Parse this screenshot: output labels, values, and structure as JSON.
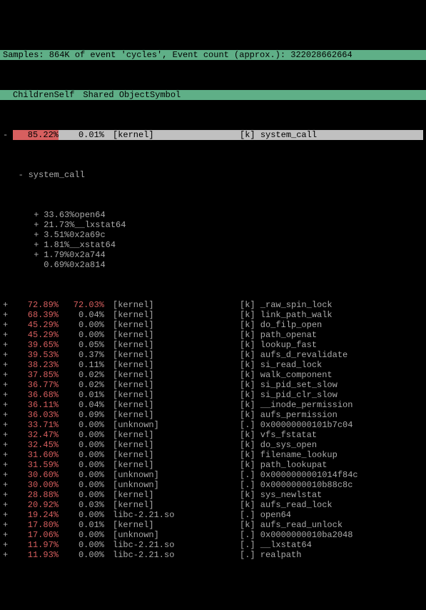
{
  "header": {
    "title_line": "Samples: 864K of event 'cycles', Event count (approx.): 322028662664",
    "cols": {
      "children": "Children",
      "self": "Self",
      "shared_object": "Shared Object",
      "symbol": "Symbol"
    }
  },
  "expanded": {
    "children": "85.22%",
    "self": "0.01%",
    "obj": "[kernel]",
    "mark": "[k]",
    "sym": "system_call",
    "tree_label": "system_call"
  },
  "tree_items": [
    {
      "exp": "+",
      "pct": "33.63%",
      "name": "open64"
    },
    {
      "exp": "+",
      "pct": "21.73%",
      "name": "__lxstat64"
    },
    {
      "exp": "+",
      "pct": "3.51%",
      "name": "0x2a69c"
    },
    {
      "exp": "+",
      "pct": "1.81%",
      "name": "__xstat64"
    },
    {
      "exp": "+",
      "pct": "1.79%",
      "name": "0x2a744"
    },
    {
      "exp": " ",
      "pct": "0.69%",
      "name": "0x2a814"
    }
  ],
  "rows": [
    {
      "exp": "+",
      "children": "72.89%",
      "self": "72.03%",
      "self_red": true,
      "obj": "[kernel]",
      "mark": "[k]",
      "sym": "_raw_spin_lock"
    },
    {
      "exp": "+",
      "children": "68.39%",
      "self": "0.04%",
      "obj": "[kernel]",
      "mark": "[k]",
      "sym": "link_path_walk"
    },
    {
      "exp": "+",
      "children": "45.29%",
      "self": "0.00%",
      "obj": "[kernel]",
      "mark": "[k]",
      "sym": "do_filp_open"
    },
    {
      "exp": "+",
      "children": "45.29%",
      "self": "0.00%",
      "obj": "[kernel]",
      "mark": "[k]",
      "sym": "path_openat"
    },
    {
      "exp": "+",
      "children": "39.65%",
      "self": "0.05%",
      "obj": "[kernel]",
      "mark": "[k]",
      "sym": "lookup_fast"
    },
    {
      "exp": "+",
      "children": "39.53%",
      "self": "0.37%",
      "obj": "[kernel]",
      "mark": "[k]",
      "sym": "aufs_d_revalidate"
    },
    {
      "exp": "+",
      "children": "38.23%",
      "self": "0.11%",
      "obj": "[kernel]",
      "mark": "[k]",
      "sym": "si_read_lock"
    },
    {
      "exp": "+",
      "children": "37.85%",
      "self": "0.02%",
      "obj": "[kernel]",
      "mark": "[k]",
      "sym": "walk_component"
    },
    {
      "exp": "+",
      "children": "36.77%",
      "self": "0.02%",
      "obj": "[kernel]",
      "mark": "[k]",
      "sym": "si_pid_set_slow"
    },
    {
      "exp": "+",
      "children": "36.68%",
      "self": "0.01%",
      "obj": "[kernel]",
      "mark": "[k]",
      "sym": "si_pid_clr_slow"
    },
    {
      "exp": "+",
      "children": "36.11%",
      "self": "0.04%",
      "obj": "[kernel]",
      "mark": "[k]",
      "sym": "__inode_permission"
    },
    {
      "exp": "+",
      "children": "36.03%",
      "self": "0.09%",
      "obj": "[kernel]",
      "mark": "[k]",
      "sym": "aufs_permission"
    },
    {
      "exp": "+",
      "children": "33.71%",
      "self": "0.00%",
      "obj": "[unknown]",
      "mark": "[.]",
      "sym": "0x00000000101b7c04"
    },
    {
      "exp": "+",
      "children": "32.47%",
      "self": "0.00%",
      "obj": "[kernel]",
      "mark": "[k]",
      "sym": "vfs_fstatat"
    },
    {
      "exp": "+",
      "children": "32.45%",
      "self": "0.00%",
      "obj": "[kernel]",
      "mark": "[k]",
      "sym": "do_sys_open"
    },
    {
      "exp": "+",
      "children": "31.60%",
      "self": "0.00%",
      "obj": "[kernel]",
      "mark": "[k]",
      "sym": "filename_lookup"
    },
    {
      "exp": "+",
      "children": "31.59%",
      "self": "0.00%",
      "obj": "[kernel]",
      "mark": "[k]",
      "sym": "path_lookupat"
    },
    {
      "exp": "+",
      "children": "30.60%",
      "self": "0.00%",
      "obj": "[unknown]",
      "mark": "[.]",
      "sym": "0x0000000001014f84c"
    },
    {
      "exp": "+",
      "children": "30.00%",
      "self": "0.00%",
      "obj": "[unknown]",
      "mark": "[.]",
      "sym": "0x0000000010b88c8c"
    },
    {
      "exp": "+",
      "children": "28.88%",
      "self": "0.00%",
      "obj": "[kernel]",
      "mark": "[k]",
      "sym": "sys_newlstat"
    },
    {
      "exp": "+",
      "children": "20.92%",
      "self": "0.03%",
      "obj": "[kernel]",
      "mark": "[k]",
      "sym": "aufs_read_lock"
    },
    {
      "exp": "+",
      "children": "19.24%",
      "self": "0.00%",
      "obj": "libc-2.21.so",
      "mark": "[.]",
      "sym": "open64"
    },
    {
      "exp": "+",
      "children": "17.80%",
      "self": "0.01%",
      "obj": "[kernel]",
      "mark": "[k]",
      "sym": "aufs_read_unlock"
    },
    {
      "exp": "+",
      "children": "17.06%",
      "self": "0.00%",
      "obj": "[unknown]",
      "mark": "[.]",
      "sym": "0x0000000010ba2048"
    },
    {
      "exp": "+",
      "children": "11.97%",
      "self": "0.00%",
      "obj": "libc-2.21.so",
      "mark": "[.]",
      "sym": "__lxstat64"
    },
    {
      "exp": "+",
      "children": "11.93%",
      "self": "0.00%",
      "obj": "libc-2.21.so",
      "mark": "[.]",
      "sym": "realpath"
    }
  ]
}
